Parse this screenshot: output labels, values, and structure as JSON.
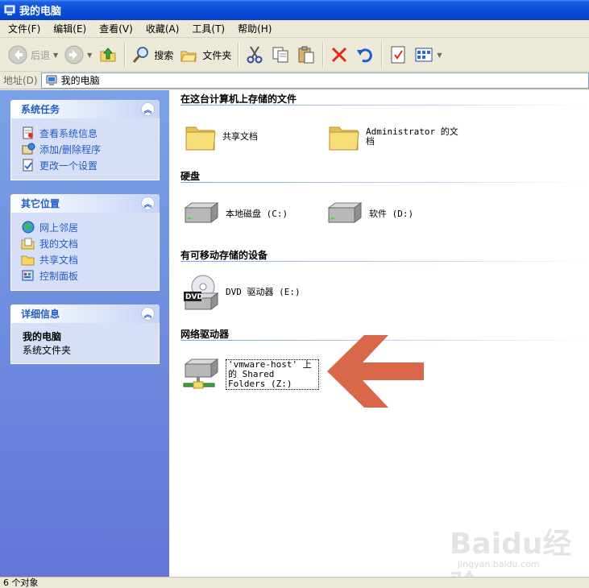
{
  "window": {
    "title": "我的电脑"
  },
  "menu": [
    "文件(F)",
    "编辑(E)",
    "查看(V)",
    "收藏(A)",
    "工具(T)",
    "帮助(H)"
  ],
  "toolbar": {
    "back": "后退",
    "search": "搜索",
    "folders": "文件夹"
  },
  "address": {
    "label": "地址(D)",
    "value": "我的电脑"
  },
  "sidebar": {
    "system_tasks": {
      "title": "系统任务",
      "items": [
        "查看系统信息",
        "添加/删除程序",
        "更改一个设置"
      ]
    },
    "other_places": {
      "title": "其它位置",
      "items": [
        "网上邻居",
        "我的文档",
        "共享文档",
        "控制面板"
      ]
    },
    "details": {
      "title": "详细信息",
      "name": "我的电脑",
      "type": "系统文件夹"
    }
  },
  "groups": {
    "stored_files": {
      "title": "在这台计算机上存储的文件",
      "items": [
        "共享文档",
        "Administrator 的文档"
      ]
    },
    "hard_disks": {
      "title": "硬盘",
      "items": [
        "本地磁盘 (C:)",
        "软件 (D:)"
      ]
    },
    "removable": {
      "title": "有可移动存储的设备",
      "items": [
        "DVD 驱动器 (E:)"
      ]
    },
    "network": {
      "title": "网络驱动器",
      "items": [
        "'vmware-host' 上的 Shared Folders (Z:)"
      ]
    }
  },
  "dvd_icon_label": "DVD",
  "status": {
    "text": "6 个对象"
  },
  "watermark": {
    "brand": "Baidu经验",
    "url": "jingyan.baidu.com"
  },
  "colors": {
    "title_blue": "#0a4ed8",
    "sidebar_link": "#215dc6",
    "arrow": "#d9674a",
    "folder": "#f5d66a"
  }
}
